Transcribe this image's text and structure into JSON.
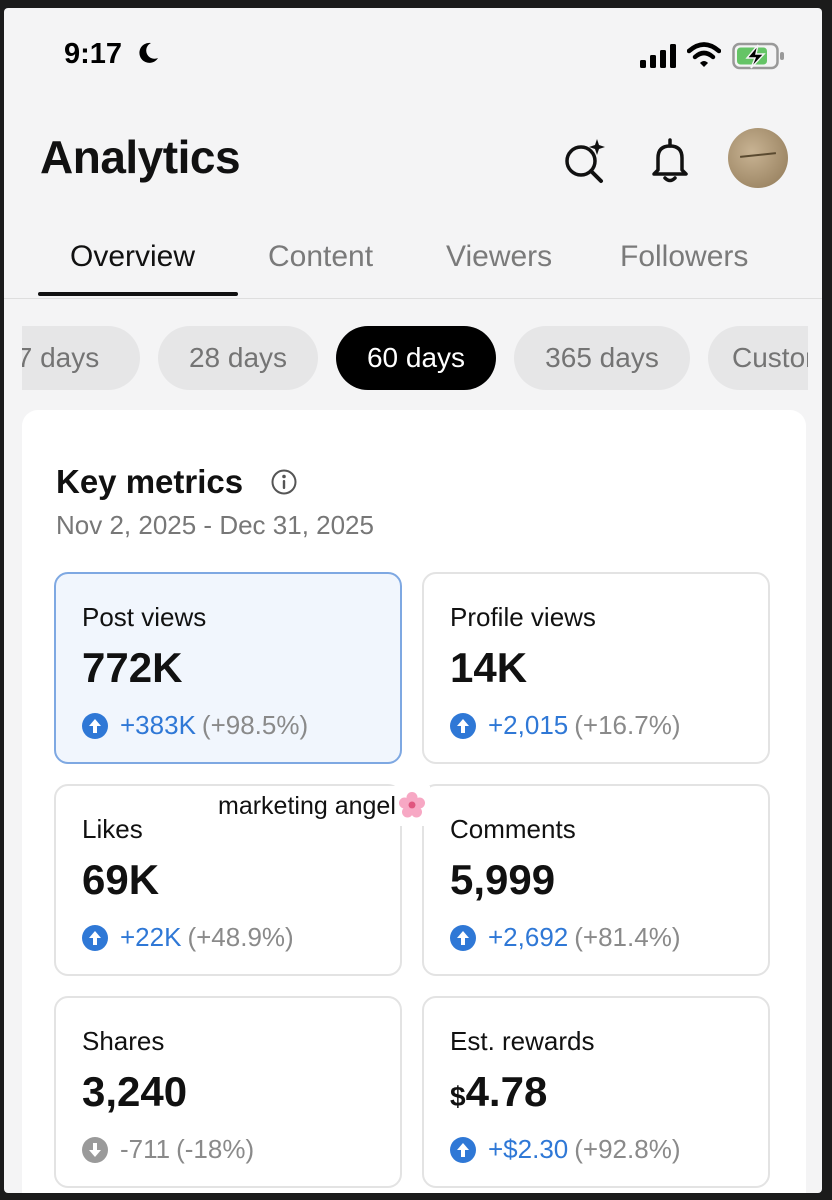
{
  "status_bar": {
    "time": "9:17"
  },
  "header": {
    "title": "Analytics"
  },
  "tabs": [
    {
      "label": "Overview",
      "active": true
    },
    {
      "label": "Content",
      "active": false
    },
    {
      "label": "Viewers",
      "active": false
    },
    {
      "label": "Followers",
      "active": false
    }
  ],
  "ranges": [
    {
      "label": "7 days",
      "active": false
    },
    {
      "label": "28 days",
      "active": false
    },
    {
      "label": "60 days",
      "active": true
    },
    {
      "label": "365 days",
      "active": false
    },
    {
      "label": "Custom",
      "active": false
    }
  ],
  "key_metrics": {
    "title": "Key metrics",
    "date_range": "Nov 2, 2025 - Dec 31, 2025",
    "metrics": [
      {
        "label": "Post views",
        "value": "772K",
        "delta": "+383K",
        "pct": "(+98.5%)",
        "direction": "up",
        "selected": true
      },
      {
        "label": "Profile views",
        "value": "14K",
        "delta": "+2,015",
        "pct": "(+16.7%)",
        "direction": "up",
        "selected": false
      },
      {
        "label": "Likes",
        "value": "69K",
        "delta": "+22K",
        "pct": "(+48.9%)",
        "direction": "up",
        "selected": false
      },
      {
        "label": "Comments",
        "value": "5,999",
        "delta": "+2,692",
        "pct": "(+81.4%)",
        "direction": "up",
        "selected": false
      },
      {
        "label": "Shares",
        "value": "3,240",
        "delta": "-711",
        "pct": "(-18%)",
        "direction": "down",
        "selected": false
      },
      {
        "label": "Est. rewards",
        "currency": "$",
        "value": "4.78",
        "delta": "+$2.30",
        "pct": "(+92.8%)",
        "direction": "up",
        "selected": false
      }
    ]
  },
  "overlay": {
    "text": "marketing angel"
  },
  "colors": {
    "accent_blue": "#2f78d6",
    "selected_bg": "#f1f6fd",
    "selected_border": "#7ea8e2",
    "chip_active": "#000000"
  }
}
